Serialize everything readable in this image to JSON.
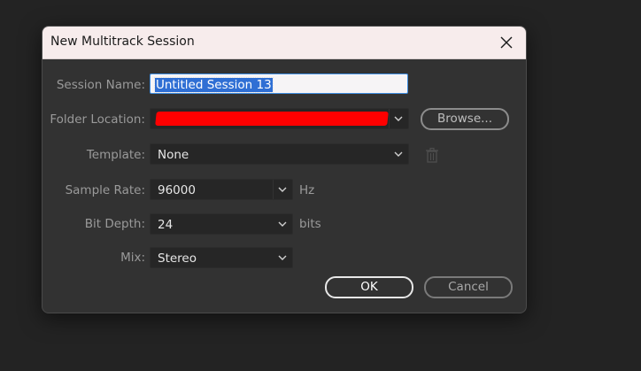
{
  "dialog": {
    "title": "New Multitrack Session",
    "close_icon": "close-icon"
  },
  "form": {
    "session_name": {
      "label": "Session Name:",
      "value": "Untitled Session 13"
    },
    "folder_location": {
      "label": "Folder Location:",
      "value_redacted": true,
      "browse_label": "Browse..."
    },
    "template": {
      "label": "Template:",
      "value": "None",
      "delete_icon": "trash-icon"
    },
    "sample_rate": {
      "label": "Sample Rate:",
      "value": "96000",
      "unit": "Hz"
    },
    "bit_depth": {
      "label": "Bit Depth:",
      "value": "24",
      "unit": "bits"
    },
    "mix": {
      "label": "Mix:",
      "value": "Stereo"
    }
  },
  "buttons": {
    "ok": "OK",
    "cancel": "Cancel"
  },
  "colors": {
    "dialog_bg": "#323232",
    "titlebar_bg": "#f7ecec",
    "selection": "#2f6fd4",
    "focus_border": "#3f8de0",
    "redaction": "#ff0000"
  }
}
